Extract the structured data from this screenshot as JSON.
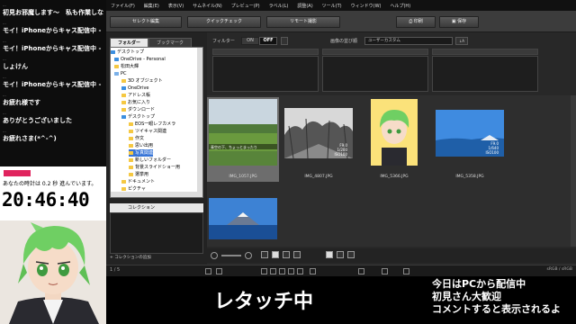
{
  "chat": {
    "messages": [
      {
        "author": "...",
        "text": "初見お邪魔します〜　私も作業しながらす〜"
      },
      {
        "author": "...",
        "text": "モイ！iPhoneからキャス配信中 -"
      },
      {
        "author": "...",
        "text": "モイ！iPhoneからキャス配信中 -"
      },
      {
        "author": "...",
        "text": "しょけん"
      },
      {
        "author": "...",
        "text": "モイ！iPhoneからキャス配信中 -"
      },
      {
        "author": "...",
        "text": "お疲れ様です"
      },
      {
        "author": "...",
        "text": "ありがとうございました"
      },
      {
        "author": "...",
        "text": "お疲れさま(*^-^)"
      }
    ]
  },
  "timer": {
    "note": "あなたの時計は 0.2 秒 進んでいます。",
    "clock": "20:46:40"
  },
  "menu": [
    "ファイル(F)",
    "編集(E)",
    "表示(V)",
    "サムネイル(N)",
    "プレビュー(P)",
    "ラベル(L)",
    "調整(A)",
    "ツール(T)",
    "ウィンドウ(W)",
    "ヘルプ(H)"
  ],
  "toolbar": {
    "select_edit": "セレクト編集",
    "quick_check": "クイックチェック",
    "remote_shoot": "リモート撮影",
    "print": "印刷",
    "save": "保存"
  },
  "folder_panel": {
    "tabs": [
      "フォルダー",
      "ブックマーク"
    ],
    "tree": [
      {
        "label": "デスクトップ",
        "icon": "desktop"
      },
      {
        "label": "OneDrive - Personal",
        "icon": "cloud"
      },
      {
        "label": "松田大輝",
        "icon": "user"
      },
      {
        "label": "PC",
        "icon": "pc"
      },
      {
        "label": "3D オブジェクト",
        "icon": "folder"
      },
      {
        "label": "OneDrive",
        "icon": "cloud"
      },
      {
        "label": "アドレス帳",
        "icon": "folder"
      },
      {
        "label": "お気に入り",
        "icon": "folder"
      },
      {
        "label": "ダウンロード",
        "icon": "folder"
      },
      {
        "label": "デスクトップ",
        "icon": "desktop"
      },
      {
        "label": "EOS一眼レフカメラ",
        "icon": "folder"
      },
      {
        "label": "ツイキャス関連",
        "icon": "folder"
      },
      {
        "label": "作文",
        "icon": "folder"
      },
      {
        "label": "思い出用",
        "icon": "folder"
      },
      {
        "label": "写真関連",
        "icon": "folder",
        "selected": true
      },
      {
        "label": "新しいフォルダー",
        "icon": "folder"
      },
      {
        "label": "背景スライドショー用",
        "icon": "folder"
      },
      {
        "label": "選挙用",
        "icon": "folder"
      },
      {
        "label": "ドキュメント",
        "icon": "folder"
      },
      {
        "label": "ピクチャ",
        "icon": "folder"
      }
    ],
    "collection": "コレクション",
    "add_collection": "コレクションの追加"
  },
  "filter": {
    "label": "フィルター",
    "on": "ON",
    "off": "OFF",
    "sort_label": "画像の並び順",
    "sort_value": "ユーザーカスタム"
  },
  "thumbnails": [
    {
      "name": "IMG_1057.JPG",
      "exif": "",
      "selected": true
    },
    {
      "name": "IMG_4807.JPG",
      "exif": "F9.0\n1/200\nISO100",
      "selected": false
    },
    {
      "name": "IMG_5366.JPG",
      "exif": "",
      "selected": false
    },
    {
      "name": "IMG_5358.JPG",
      "exif": "F9.0\n1/640\nISO100",
      "selected": false
    },
    {
      "name": "",
      "exif": "",
      "selected": false
    }
  ],
  "thumb_caption": "青空の下、ちょっとまったり",
  "status": {
    "count": "1 / 5",
    "color": "sRGB / sRGB"
  },
  "overlay": {
    "title": "レタッチ中",
    "lines": [
      "今日はPCから配信中",
      "初見さん大歓迎",
      "コメントすると表示されるよ"
    ]
  },
  "colors": {
    "selection": "#3875d7",
    "app_bg": "#2b2b2b",
    "timer_tag": "#e0245e"
  }
}
